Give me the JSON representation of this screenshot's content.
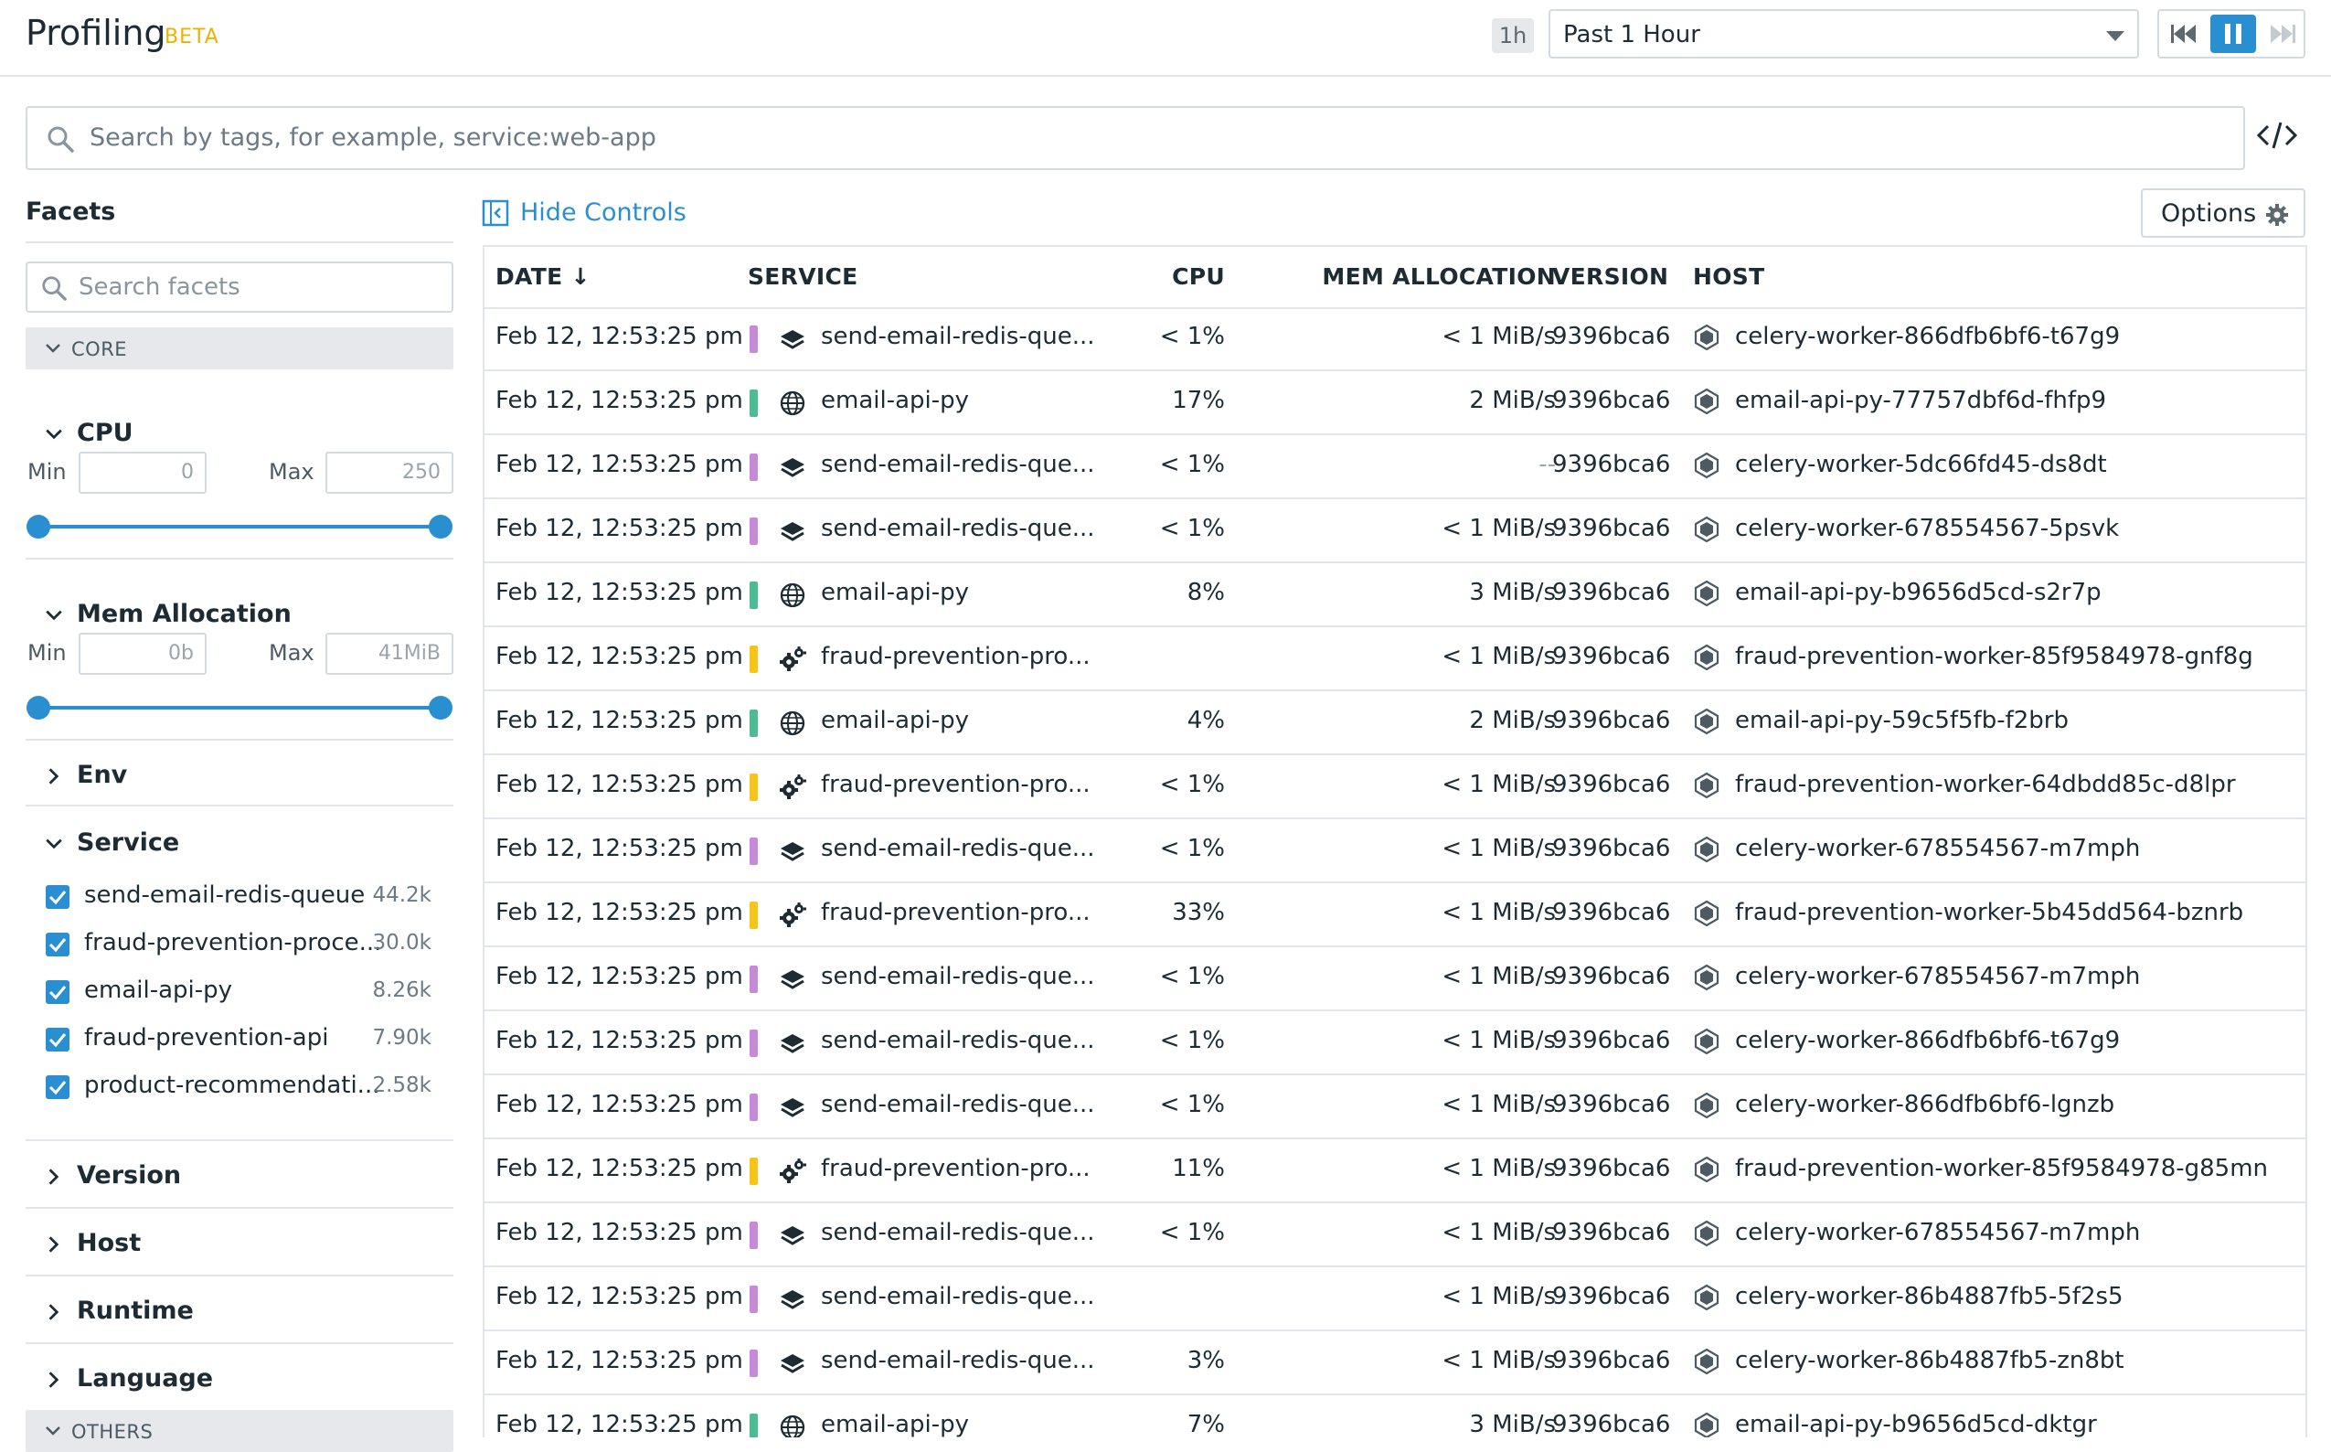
{
  "header": {
    "title": "Profiling",
    "beta": "BETA",
    "timeframe_badge": "1h",
    "timeframe_value": "Past 1 Hour"
  },
  "search": {
    "placeholder": "Search by tags, for example, service:web-app"
  },
  "sidebar": {
    "title": "Facets",
    "search_placeholder": "Search facets",
    "core_label": "CORE",
    "others_label": "OTHERS",
    "cpu": {
      "label": "CPU",
      "min_label": "Min",
      "max_label": "Max",
      "min_value": "0",
      "max_value": "250",
      "range": [
        0,
        1
      ]
    },
    "mem": {
      "label": "Mem Allocation",
      "min_label": "Min",
      "max_label": "Max",
      "min_value": "0b",
      "max_value": "41MiB",
      "range": [
        0,
        1
      ]
    },
    "env_label": "Env",
    "service_label": "Service",
    "services": [
      {
        "name": "send-email-redis-queue",
        "count": "44.2k",
        "checked": true
      },
      {
        "name": "fraud-prevention-proce...",
        "count": "30.0k",
        "checked": true
      },
      {
        "name": "email-api-py",
        "count": "8.26k",
        "checked": true
      },
      {
        "name": "fraud-prevention-api",
        "count": "7.90k",
        "checked": true
      },
      {
        "name": "product-recommendati...",
        "count": "2.58k",
        "checked": true
      }
    ],
    "version_label": "Version",
    "host_label": "Host",
    "runtime_label": "Runtime",
    "language_label": "Language"
  },
  "main": {
    "hide_controls": "Hide Controls",
    "options": "Options"
  },
  "table": {
    "columns": {
      "date": "DATE",
      "service": "SERVICE",
      "cpu": "CPU",
      "mem": "MEM ALLOCATION",
      "version": "VERSION",
      "host": "HOST"
    },
    "sort_indicator": "↓",
    "colors": {
      "purple": "#c78ad6",
      "green": "#4dbb94",
      "yellow": "#f5c518"
    },
    "rows": [
      {
        "date": "Feb 12, 12:53:25 pm",
        "service": "send-email-redis-que...",
        "svc_color": "#c78ad6",
        "svc_icon": "layers-icon",
        "cpu": "< 1%",
        "mem": "< 1 MiB/s",
        "version": "9396bca6",
        "host": "celery-worker-866dfb6bf6-t67g9"
      },
      {
        "date": "Feb 12, 12:53:25 pm",
        "service": "email-api-py",
        "svc_color": "#4dbb94",
        "svc_icon": "globe-icon",
        "cpu": "17%",
        "mem": "2 MiB/s",
        "version": "9396bca6",
        "host": "email-api-py-77757dbf6d-fhfp9"
      },
      {
        "date": "Feb 12, 12:53:25 pm",
        "service": "send-email-redis-que...",
        "svc_color": "#c78ad6",
        "svc_icon": "layers-icon",
        "cpu": "< 1%",
        "mem": "--",
        "version": "9396bca6",
        "host": "celery-worker-5dc66fd45-ds8dt"
      },
      {
        "date": "Feb 12, 12:53:25 pm",
        "service": "send-email-redis-que...",
        "svc_color": "#c78ad6",
        "svc_icon": "layers-icon",
        "cpu": "< 1%",
        "mem": "< 1 MiB/s",
        "version": "9396bca6",
        "host": "celery-worker-678554567-5psvk"
      },
      {
        "date": "Feb 12, 12:53:25 pm",
        "service": "email-api-py",
        "svc_color": "#4dbb94",
        "svc_icon": "globe-icon",
        "cpu": "8%",
        "mem": "3 MiB/s",
        "version": "9396bca6",
        "host": "email-api-py-b9656d5cd-s2r7p"
      },
      {
        "date": "Feb 12, 12:53:25 pm",
        "service": "fraud-prevention-pro...",
        "svc_color": "#f5c518",
        "svc_icon": "gears-icon",
        "cpu": "",
        "mem": "< 1 MiB/s",
        "version": "9396bca6",
        "host": "fraud-prevention-worker-85f9584978-gnf8g"
      },
      {
        "date": "Feb 12, 12:53:25 pm",
        "service": "email-api-py",
        "svc_color": "#4dbb94",
        "svc_icon": "globe-icon",
        "cpu": "4%",
        "mem": "2 MiB/s",
        "version": "9396bca6",
        "host": "email-api-py-59c5f5fb-f2brb"
      },
      {
        "date": "Feb 12, 12:53:25 pm",
        "service": "fraud-prevention-pro...",
        "svc_color": "#f5c518",
        "svc_icon": "gears-icon",
        "cpu": "< 1%",
        "mem": "< 1 MiB/s",
        "version": "9396bca6",
        "host": "fraud-prevention-worker-64dbdd85c-d8lpr"
      },
      {
        "date": "Feb 12, 12:53:25 pm",
        "service": "send-email-redis-que...",
        "svc_color": "#c78ad6",
        "svc_icon": "layers-icon",
        "cpu": "< 1%",
        "mem": "< 1 MiB/s",
        "version": "9396bca6",
        "host": "celery-worker-678554567-m7mph"
      },
      {
        "date": "Feb 12, 12:53:25 pm",
        "service": "fraud-prevention-pro...",
        "svc_color": "#f5c518",
        "svc_icon": "gears-icon",
        "cpu": "33%",
        "mem": "< 1 MiB/s",
        "version": "9396bca6",
        "host": "fraud-prevention-worker-5b45dd564-bznrb"
      },
      {
        "date": "Feb 12, 12:53:25 pm",
        "service": "send-email-redis-que...",
        "svc_color": "#c78ad6",
        "svc_icon": "layers-icon",
        "cpu": "< 1%",
        "mem": "< 1 MiB/s",
        "version": "9396bca6",
        "host": "celery-worker-678554567-m7mph"
      },
      {
        "date": "Feb 12, 12:53:25 pm",
        "service": "send-email-redis-que...",
        "svc_color": "#c78ad6",
        "svc_icon": "layers-icon",
        "cpu": "< 1%",
        "mem": "< 1 MiB/s",
        "version": "9396bca6",
        "host": "celery-worker-866dfb6bf6-t67g9"
      },
      {
        "date": "Feb 12, 12:53:25 pm",
        "service": "send-email-redis-que...",
        "svc_color": "#c78ad6",
        "svc_icon": "layers-icon",
        "cpu": "< 1%",
        "mem": "< 1 MiB/s",
        "version": "9396bca6",
        "host": "celery-worker-866dfb6bf6-lgnzb"
      },
      {
        "date": "Feb 12, 12:53:25 pm",
        "service": "fraud-prevention-pro...",
        "svc_color": "#f5c518",
        "svc_icon": "gears-icon",
        "cpu": "11%",
        "mem": "< 1 MiB/s",
        "version": "9396bca6",
        "host": "fraud-prevention-worker-85f9584978-g85mn"
      },
      {
        "date": "Feb 12, 12:53:25 pm",
        "service": "send-email-redis-que...",
        "svc_color": "#c78ad6",
        "svc_icon": "layers-icon",
        "cpu": "< 1%",
        "mem": "< 1 MiB/s",
        "version": "9396bca6",
        "host": "celery-worker-678554567-m7mph"
      },
      {
        "date": "Feb 12, 12:53:25 pm",
        "service": "send-email-redis-que...",
        "svc_color": "#c78ad6",
        "svc_icon": "layers-icon",
        "cpu": "",
        "mem": "< 1 MiB/s",
        "version": "9396bca6",
        "host": "celery-worker-86b4887fb5-5f2s5"
      },
      {
        "date": "Feb 12, 12:53:25 pm",
        "service": "send-email-redis-que...",
        "svc_color": "#c78ad6",
        "svc_icon": "layers-icon",
        "cpu": "3%",
        "mem": "< 1 MiB/s",
        "version": "9396bca6",
        "host": "celery-worker-86b4887fb5-zn8bt"
      },
      {
        "date": "Feb 12, 12:53:25 pm",
        "service": "email-api-py",
        "svc_color": "#4dbb94",
        "svc_icon": "globe-icon",
        "cpu": "7%",
        "mem": "3 MiB/s",
        "version": "9396bca6",
        "host": "email-api-py-b9656d5cd-dktgr"
      }
    ]
  }
}
